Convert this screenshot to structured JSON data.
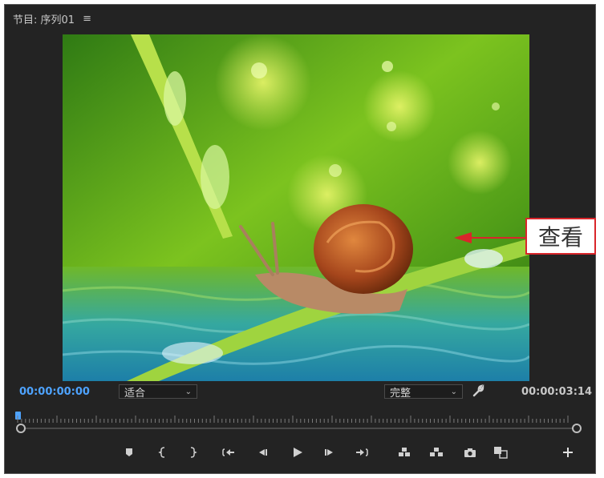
{
  "panel": {
    "title": "节目: 序列01",
    "menu_icon": "≡"
  },
  "timecode": {
    "current": "00:00:00:00",
    "duration": "00:00:03:14"
  },
  "zoom_select": {
    "value": "适合"
  },
  "quality_select": {
    "value": "完整"
  },
  "callout": {
    "label": "查看"
  },
  "icons": {
    "settings": "wrench-icon",
    "add_marker": "marker-icon",
    "mark_in": "mark-in-icon",
    "mark_out": "mark-out-icon",
    "go_to_in": "go-to-in-icon",
    "step_back": "step-back-icon",
    "play": "play-icon",
    "step_forward": "step-forward-icon",
    "go_to_out": "go-to-out-icon",
    "lift": "lift-icon",
    "extract": "extract-icon",
    "export_frame": "camera-icon",
    "compare": "compare-view-icon",
    "button_editor": "plus-icon"
  },
  "colors": {
    "timecode_blue": "#4ea3ff",
    "panel_bg": "#232323",
    "callout_red": "#d9262b"
  }
}
